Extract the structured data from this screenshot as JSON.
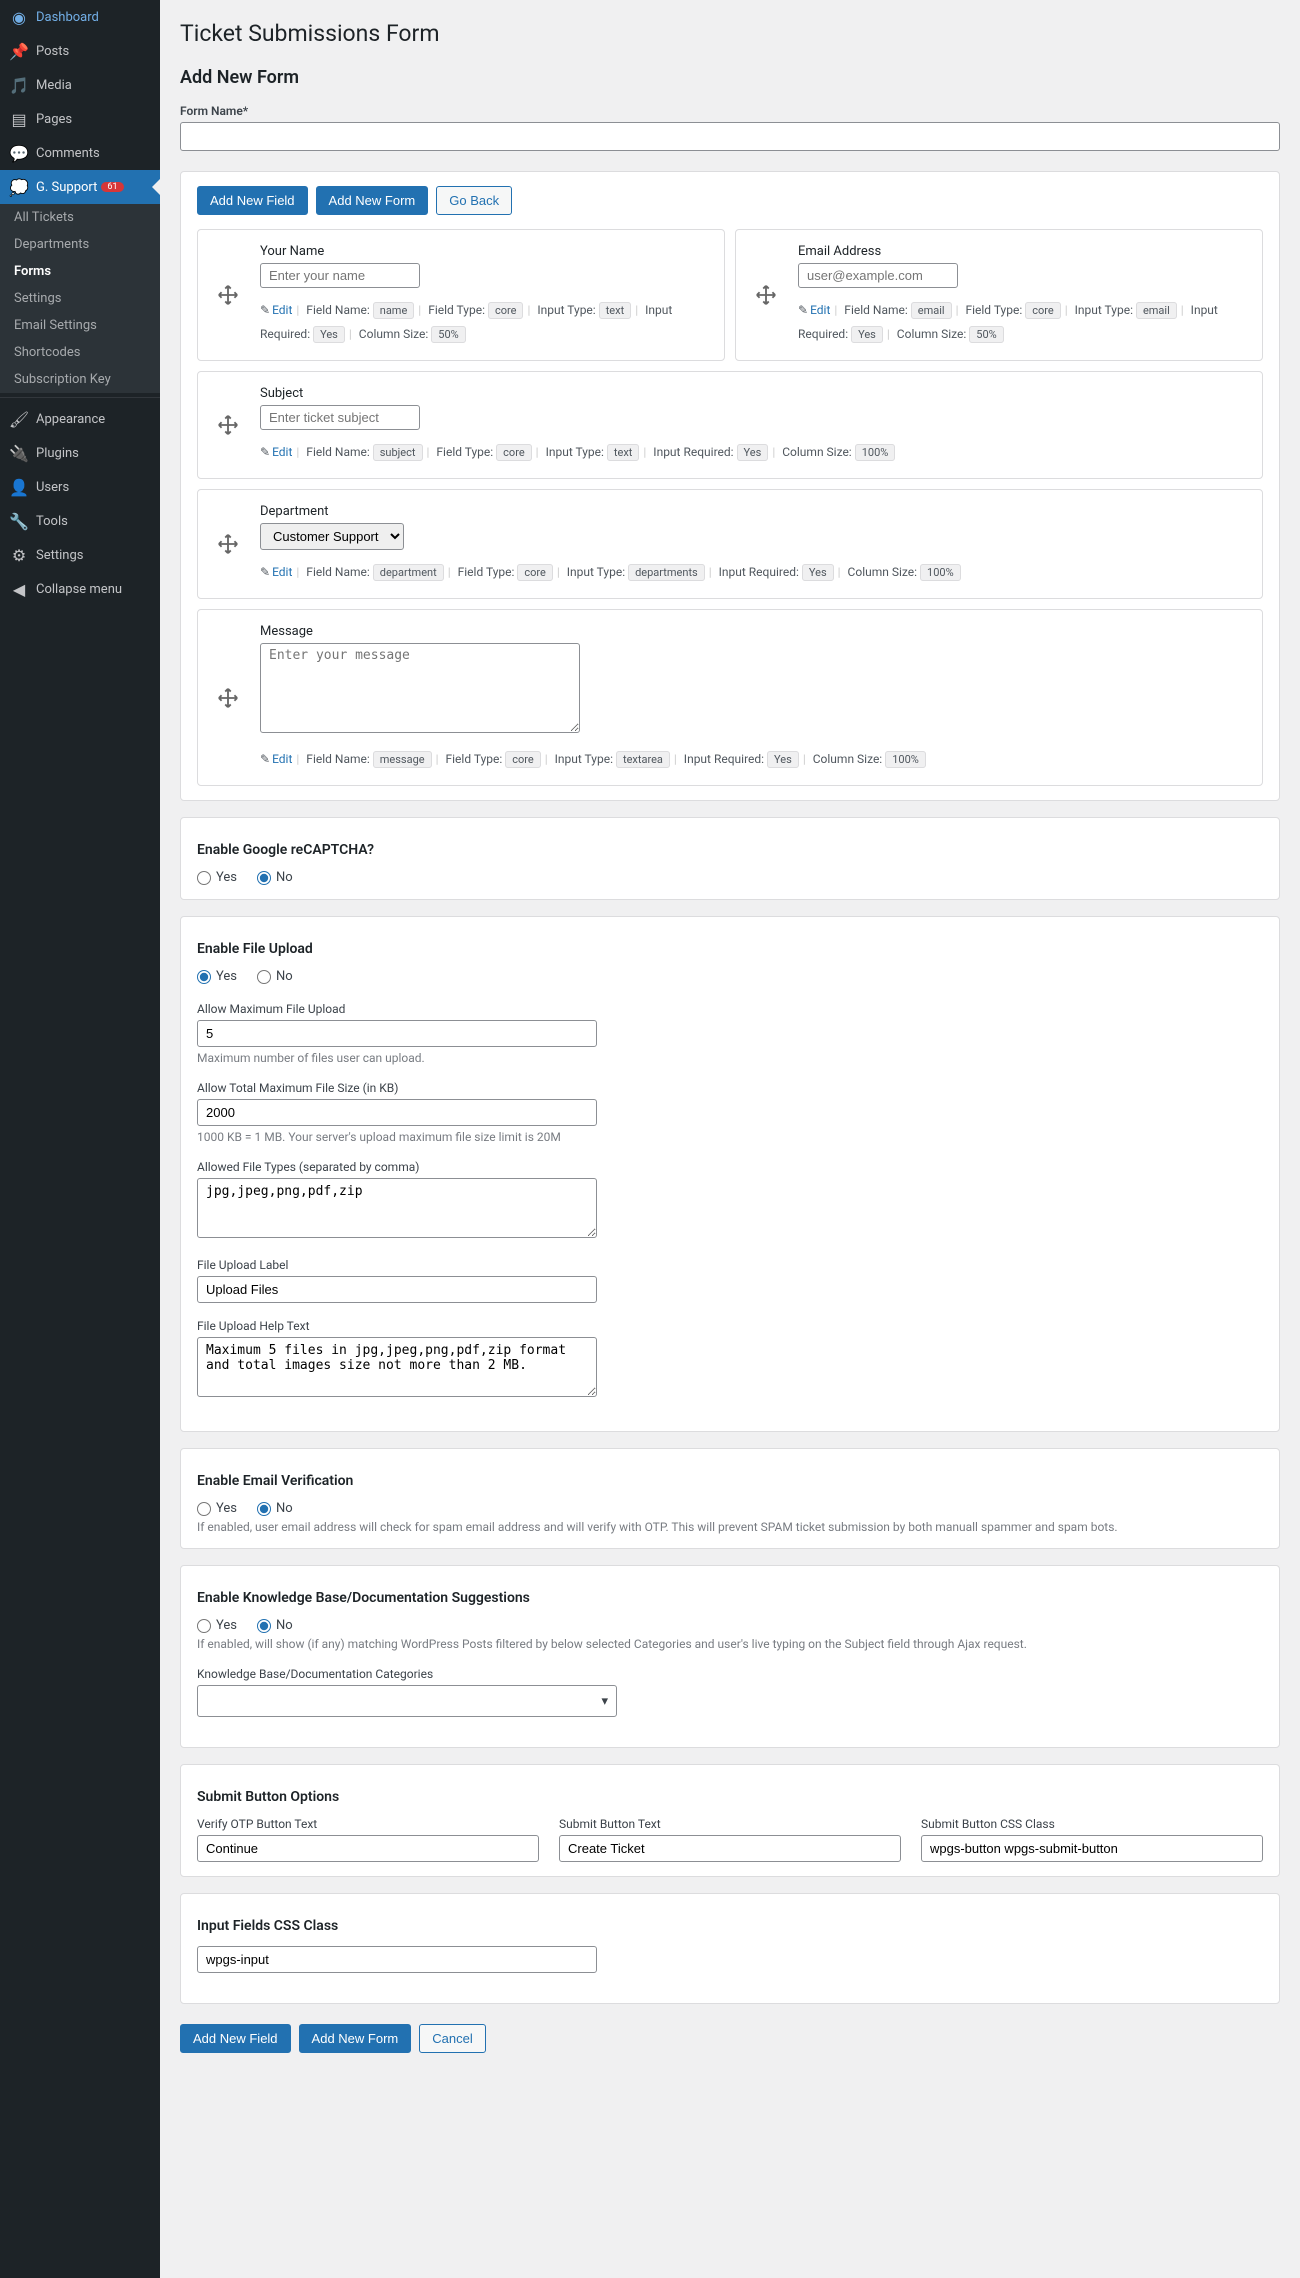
{
  "sidebar": {
    "items": [
      {
        "icon": "dashboard",
        "label": "Dashboard"
      },
      {
        "icon": "pin",
        "label": "Posts"
      },
      {
        "icon": "media",
        "label": "Media"
      },
      {
        "icon": "pages",
        "label": "Pages"
      },
      {
        "icon": "comments",
        "label": "Comments"
      },
      {
        "icon": "support",
        "label": "G. Support",
        "badge": "61",
        "active": true
      }
    ],
    "submenu": [
      {
        "label": "All Tickets"
      },
      {
        "label": "Departments"
      },
      {
        "label": "Forms",
        "current": true
      },
      {
        "label": "Settings"
      },
      {
        "label": "Email Settings"
      },
      {
        "label": "Shortcodes"
      },
      {
        "label": "Subscription Key"
      }
    ],
    "items2": [
      {
        "icon": "brush",
        "label": "Appearance"
      },
      {
        "icon": "plugin",
        "label": "Plugins"
      },
      {
        "icon": "users",
        "label": "Users"
      },
      {
        "icon": "tools",
        "label": "Tools"
      },
      {
        "icon": "settings",
        "label": "Settings"
      },
      {
        "icon": "collapse",
        "label": "Collapse menu"
      }
    ]
  },
  "page": {
    "title": "Ticket Submissions Form",
    "add_new_form_heading": "Add New Form",
    "form_name_label": "Form Name*",
    "form_name_value": ""
  },
  "buttons": {
    "add_new_field": "Add New Field",
    "add_new_form": "Add New Form",
    "go_back": "Go Back",
    "cancel": "Cancel"
  },
  "meta_labels": {
    "edit": "Edit",
    "field_name": "Field Name:",
    "field_type": "Field Type:",
    "input_type": "Input Type:",
    "input_required": "Input Required:",
    "column_size": "Column Size:"
  },
  "fields": [
    {
      "label": "Your Name",
      "placeholder": "Enter your name",
      "field_name": "name",
      "field_type": "core",
      "input_type": "text",
      "required": "Yes",
      "col": "50%",
      "width": "half",
      "kind": "text"
    },
    {
      "label": "Email Address",
      "placeholder": "user@example.com",
      "field_name": "email",
      "field_type": "core",
      "input_type": "email",
      "required": "Yes",
      "col": "50%",
      "width": "half",
      "kind": "text"
    },
    {
      "label": "Subject",
      "placeholder": "Enter ticket subject",
      "field_name": "subject",
      "field_type": "core",
      "input_type": "text",
      "required": "Yes",
      "col": "100%",
      "width": "full",
      "kind": "text"
    },
    {
      "label": "Department",
      "option": "Customer Support",
      "field_name": "department",
      "field_type": "core",
      "input_type": "departments",
      "required": "Yes",
      "col": "100%",
      "width": "full",
      "kind": "select"
    },
    {
      "label": "Message",
      "placeholder": "Enter your message",
      "field_name": "message",
      "field_type": "core",
      "input_type": "textarea",
      "required": "Yes",
      "col": "100%",
      "width": "full",
      "kind": "textarea"
    }
  ],
  "recaptcha": {
    "heading": "Enable Google reCAPTCHA?",
    "yes": "Yes",
    "no": "No",
    "value": "No"
  },
  "file_upload": {
    "heading": "Enable File Upload",
    "yes": "Yes",
    "no": "No",
    "value": "Yes",
    "max_upload_label": "Allow Maximum File Upload",
    "max_upload_value": "5",
    "max_upload_help": "Maximum number of files user can upload.",
    "max_size_label": "Allow Total Maximum File Size (in KB)",
    "max_size_value": "2000",
    "max_size_help": "1000 KB = 1 MB. Your server's upload maximum file size limit is 20M",
    "allowed_types_label": "Allowed File Types (separated by comma)",
    "allowed_types_value": "jpg,jpeg,png,pdf,zip",
    "upload_label_label": "File Upload Label",
    "upload_label_value": "Upload Files",
    "help_text_label": "File Upload Help Text",
    "help_text_value": "Maximum 5 files in jpg,jpeg,png,pdf,zip format and total images size not more than 2 MB."
  },
  "email_verify": {
    "heading": "Enable Email Verification",
    "yes": "Yes",
    "no": "No",
    "value": "No",
    "help": "If enabled, user email address will check for spam email address and will verify with OTP. This will prevent SPAM ticket submission by both manuall spammer and spam bots."
  },
  "kb": {
    "heading": "Enable Knowledge Base/Documentation Suggestions",
    "yes": "Yes",
    "no": "No",
    "value": "No",
    "help": "If enabled, will show (if any) matching WordPress Posts filtered by below selected Categories and user's live typing on the Subject field through Ajax request.",
    "cat_label": "Knowledge Base/Documentation Categories"
  },
  "submit_opts": {
    "heading": "Submit Button Options",
    "otp_label": "Verify OTP Button Text",
    "otp_value": "Continue",
    "submit_label": "Submit Button Text",
    "submit_value": "Create Ticket",
    "css_label": "Submit Button CSS Class",
    "css_value": "wpgs-button wpgs-submit-button"
  },
  "input_css": {
    "heading": "Input Fields CSS Class",
    "value": "wpgs-input"
  }
}
